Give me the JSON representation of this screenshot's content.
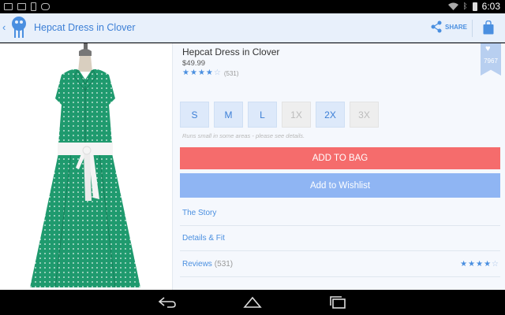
{
  "status_bar": {
    "time": "6:03",
    "icons": [
      "image-icon",
      "gmail-icon",
      "phone-icon",
      "gamepad-icon",
      "wifi-icon",
      "bluetooth-icon",
      "battery-icon"
    ]
  },
  "action_bar": {
    "title": "Hepcat Dress in Clover",
    "share_label": "SHARE",
    "accent_color": "#3c7fd6"
  },
  "product": {
    "name": "Hepcat Dress in Clover",
    "price": "$49.99",
    "rating_stars": 4,
    "rating_max": 5,
    "review_count": "(531)",
    "favorite_count": "7967",
    "image": "green-polka-dot-dress-on-mannequin"
  },
  "sizes": [
    {
      "label": "S",
      "available": true
    },
    {
      "label": "M",
      "available": true
    },
    {
      "label": "L",
      "available": true
    },
    {
      "label": "1X",
      "available": false
    },
    {
      "label": "2X",
      "available": true
    },
    {
      "label": "3X",
      "available": false
    }
  ],
  "size_note": "Runs small in some areas - please see details.",
  "buttons": {
    "add_to_bag": "ADD TO BAG",
    "add_to_wishlist": "Add to Wishlist",
    "add_to_bag_color": "#f56c6c",
    "wishlist_color": "#8fb5f3"
  },
  "sections": [
    {
      "label": "The Story"
    },
    {
      "label": "Details & Fit"
    },
    {
      "label": "Reviews",
      "count": "(531)"
    }
  ],
  "nav_bar": {
    "icons": [
      "back-icon",
      "home-icon",
      "recent-apps-icon"
    ]
  }
}
